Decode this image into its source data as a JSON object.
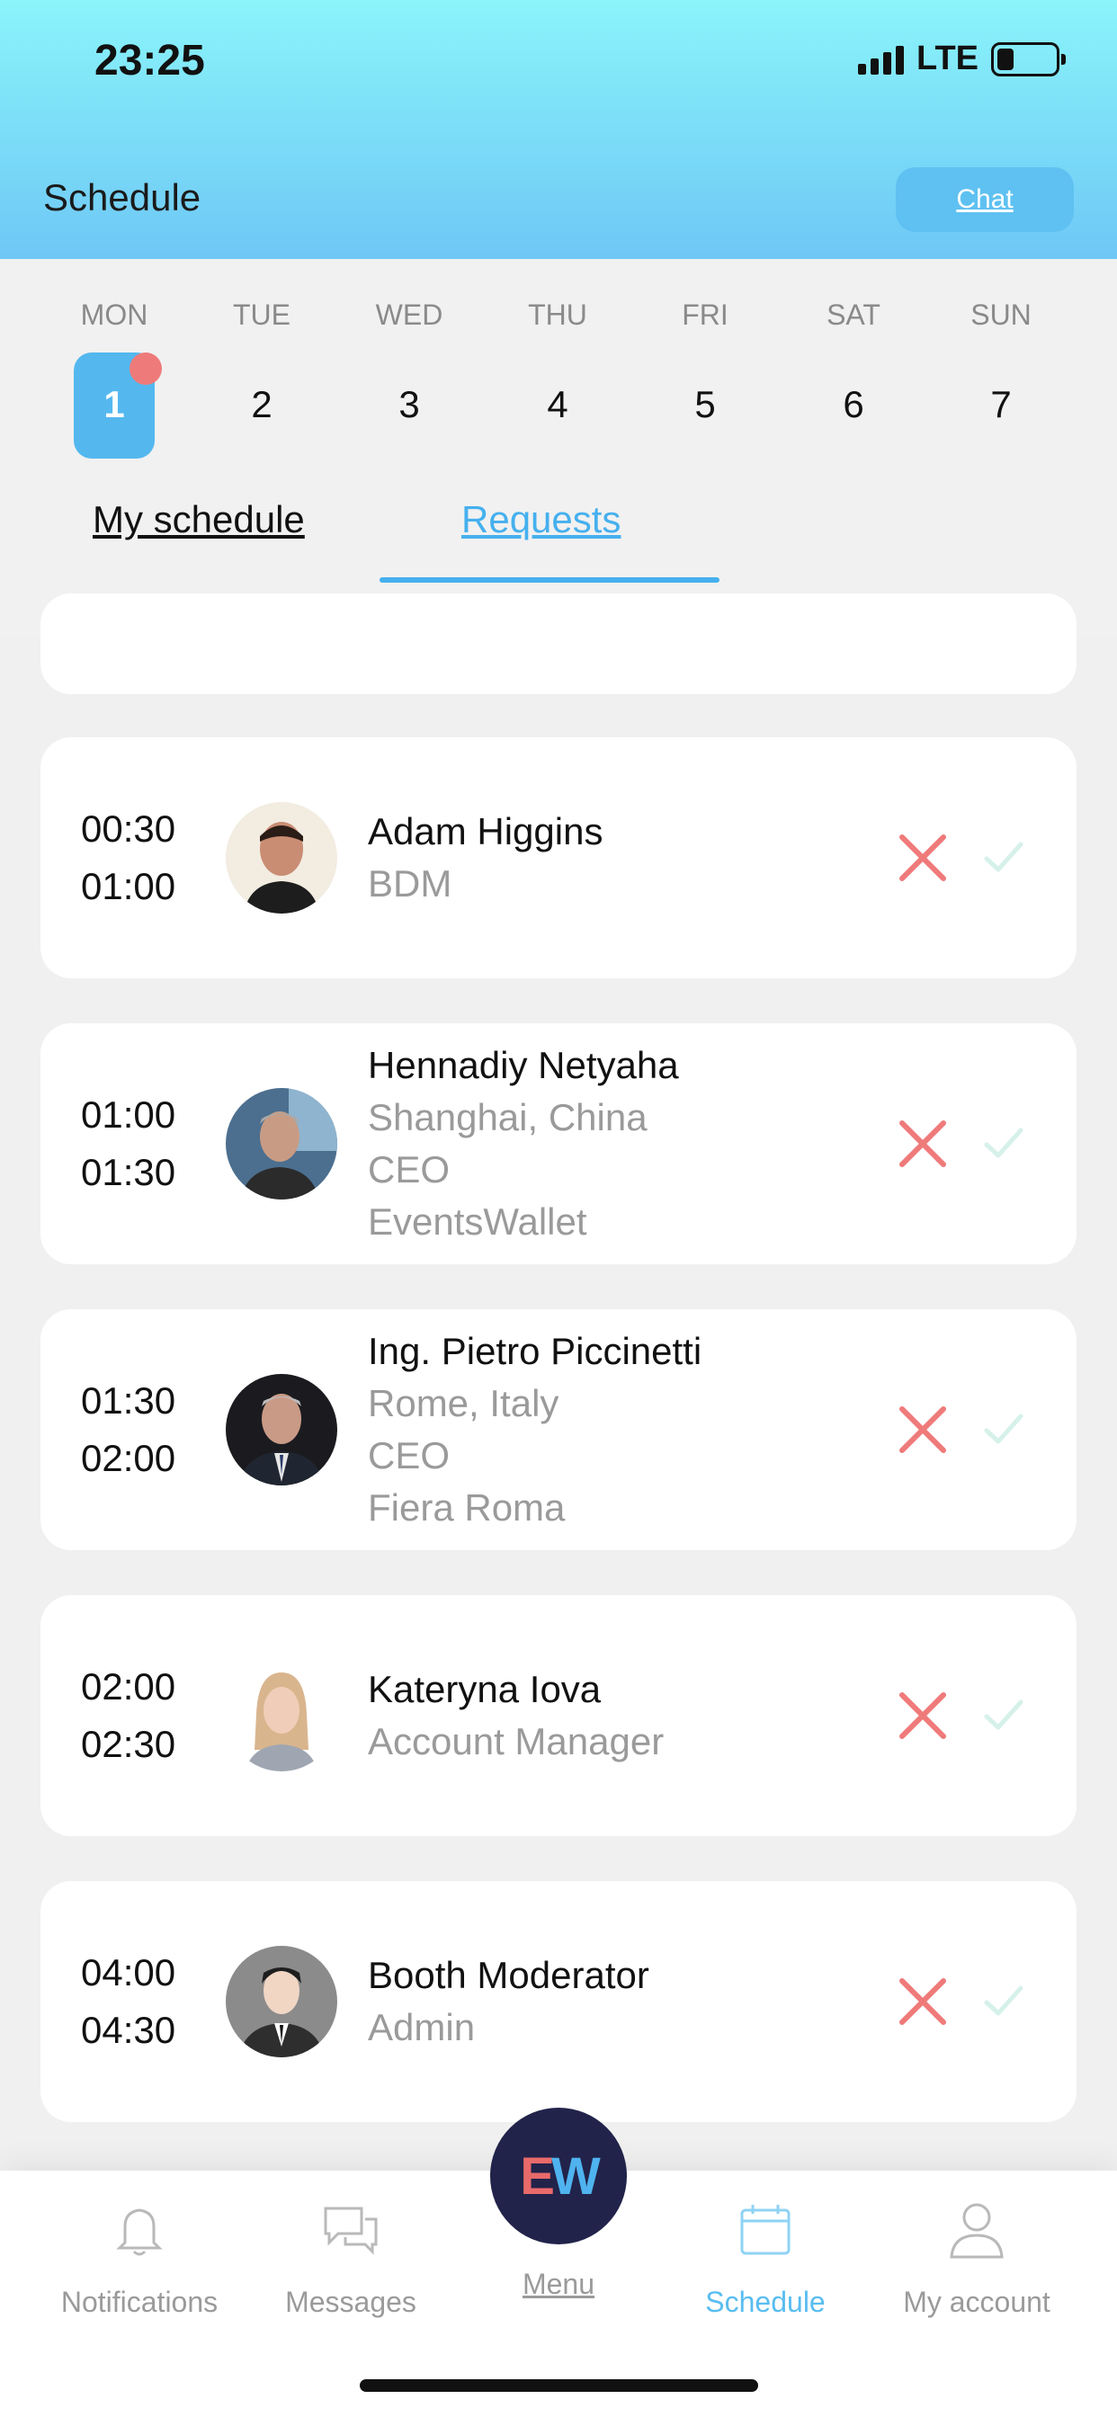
{
  "status_bar": {
    "time": "23:25",
    "network": "LTE"
  },
  "header": {
    "title": "Schedule",
    "chat_label": "Chat"
  },
  "calendar": {
    "days": [
      {
        "name": "MON",
        "date": "1"
      },
      {
        "name": "TUE",
        "date": "2"
      },
      {
        "name": "WED",
        "date": "3"
      },
      {
        "name": "THU",
        "date": "4"
      },
      {
        "name": "FRI",
        "date": "5"
      },
      {
        "name": "SAT",
        "date": "6"
      },
      {
        "name": "SUN",
        "date": "7"
      }
    ],
    "selected": "1"
  },
  "tabs": {
    "my_schedule": "My schedule",
    "requests": "Requests"
  },
  "requests": [
    {
      "start": "00:30",
      "end": "01:00",
      "name": "Adam Higgins",
      "lines": [
        "BDM"
      ]
    },
    {
      "start": "01:00",
      "end": "01:30",
      "name": "Hennadiy Netyaha",
      "lines": [
        "Shanghai, China",
        "CEO",
        "EventsWallet"
      ]
    },
    {
      "start": "01:30",
      "end": "02:00",
      "name": "Ing. Pietro Piccinetti",
      "lines": [
        "Rome, Italy",
        "CEO",
        "Fiera Roma"
      ]
    },
    {
      "start": "02:00",
      "end": "02:30",
      "name": "Kateryna Iova",
      "lines": [
        "Account Manager"
      ]
    },
    {
      "start": "04:00",
      "end": "04:30",
      "name": "Booth Moderator",
      "lines": [
        "Admin"
      ]
    }
  ],
  "nav": {
    "notifications": "Notifications",
    "messages": "Messages",
    "menu": "Menu",
    "schedule": "Schedule",
    "account": "My account",
    "menu_logo": {
      "e": "E",
      "w": "W"
    }
  },
  "colors": {
    "accent": "#54b8ef",
    "reject": "#ef7a7a",
    "accept": "#d6f1ea",
    "menu": "#22234a"
  }
}
